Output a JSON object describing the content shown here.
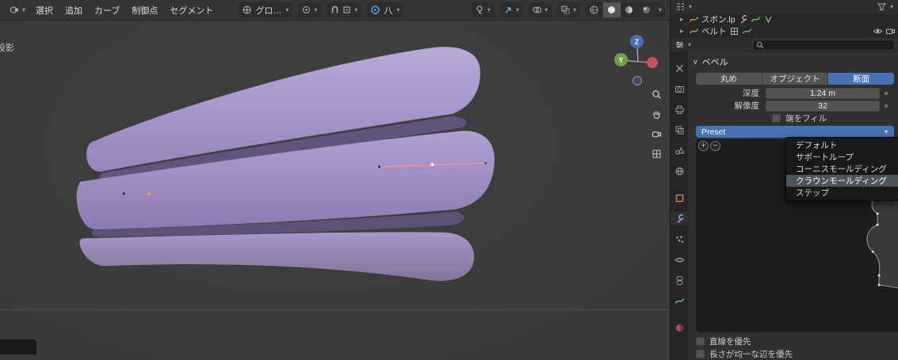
{
  "colors": {
    "accent": "#4772b4",
    "object_purple": "#a494c6"
  },
  "viewport": {
    "menus": [
      "選択",
      "追加",
      "カーブ",
      "制御点",
      "セグメント"
    ],
    "orientation_label": "グロ…",
    "falloff_label": "八",
    "overlay_label": "投影",
    "gizmo": {
      "z_label": "Z",
      "y_label": "Y"
    }
  },
  "outliner": {
    "rows": [
      "スボン.lp",
      "ベルト"
    ]
  },
  "properties": {
    "panel_title": "ベベル",
    "tabs": [
      "丸め",
      "オブジェクト",
      "断面"
    ],
    "active_tab": "断面",
    "fields": {
      "depth_label": "深度",
      "depth_value": "1.24 m",
      "resolution_label": "解像度",
      "resolution_value": "32",
      "fill_caps_label": "端をフィル"
    },
    "preset": {
      "label": "Preset",
      "menu_items": [
        "デフォルト",
        "サポートループ",
        "コーニスモールディング",
        "クラウンモールディング",
        "ステップ"
      ],
      "highlighted_item": "クラウンモールディング"
    },
    "profile_options": {
      "prefer_straight": "直線を優先",
      "prefer_even": "長さが均一な辺を優先"
    }
  },
  "glyphs": {
    "chevron_down": "▾",
    "section_open": "∨",
    "row_collapsed": "▸",
    "plus": "+",
    "minus": "−"
  }
}
